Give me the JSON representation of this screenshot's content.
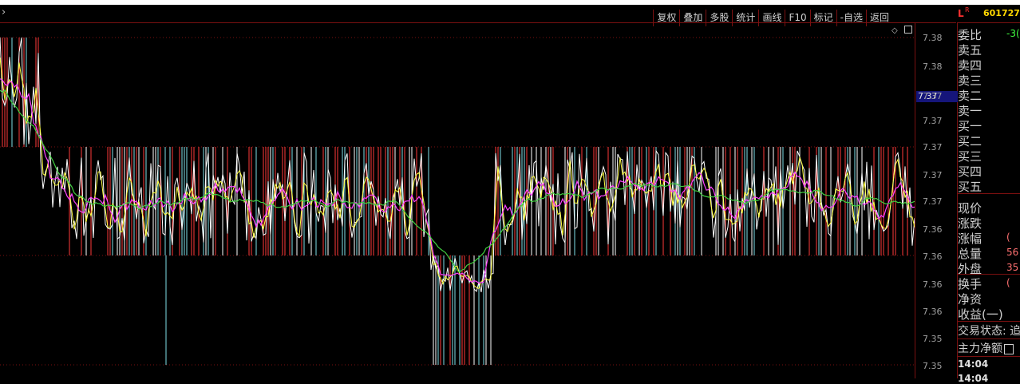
{
  "toolbar": {
    "expand_icon": "chevron-right-icon",
    "buttons": [
      "复权",
      "叠加",
      "多股",
      "统计",
      "画线",
      "F10",
      "标记",
      "-自选",
      "返回"
    ]
  },
  "quote": {
    "market_flag": "L",
    "superscript": "R",
    "code": "601727",
    "rows": [
      {
        "label": "委比",
        "value": "-3("
      },
      {
        "label": "卖五",
        "value": ""
      },
      {
        "label": "卖四",
        "value": ""
      },
      {
        "label": "卖三",
        "value": ""
      },
      {
        "label": "卖二",
        "value": ""
      },
      {
        "label": "卖一",
        "value": ""
      },
      {
        "label": "买一",
        "value": ""
      },
      {
        "label": "买二",
        "value": ""
      },
      {
        "label": "买三",
        "value": ""
      },
      {
        "label": "买四",
        "value": ""
      },
      {
        "label": "买五",
        "value": ""
      },
      {
        "label": "现价",
        "value": ""
      },
      {
        "label": "涨跌",
        "value": ""
      },
      {
        "label": "涨幅",
        "value": "("
      },
      {
        "label": "总量",
        "value": "56"
      },
      {
        "label": "外盘",
        "value": "35"
      },
      {
        "label": "换手",
        "value": "("
      },
      {
        "label": "净资",
        "value": ""
      },
      {
        "label": "收益(一)",
        "value": ""
      }
    ],
    "trade_status": "交易状态: 追",
    "net_main": "主力净额",
    "times": [
      "14:04",
      "14:04"
    ]
  },
  "price_axis": {
    "labels": [
      "7.38",
      "7.38",
      "7.37",
      "7.37",
      "7.37",
      "7.37",
      "7.37",
      "7.36",
      "7.36",
      "7.36",
      "7.36",
      "7.35",
      "7.35"
    ],
    "current_price": "7.37"
  },
  "colors": {
    "up": "#ff3a3a",
    "down": "#7fdfe8",
    "price_line": "#ffffff",
    "avg_line": "#ffff40",
    "ma_magenta": "#ff40ff",
    "ma_green": "#40d040",
    "grid": "#7a1010",
    "axis_bg_highlight": "#15157a"
  }
}
